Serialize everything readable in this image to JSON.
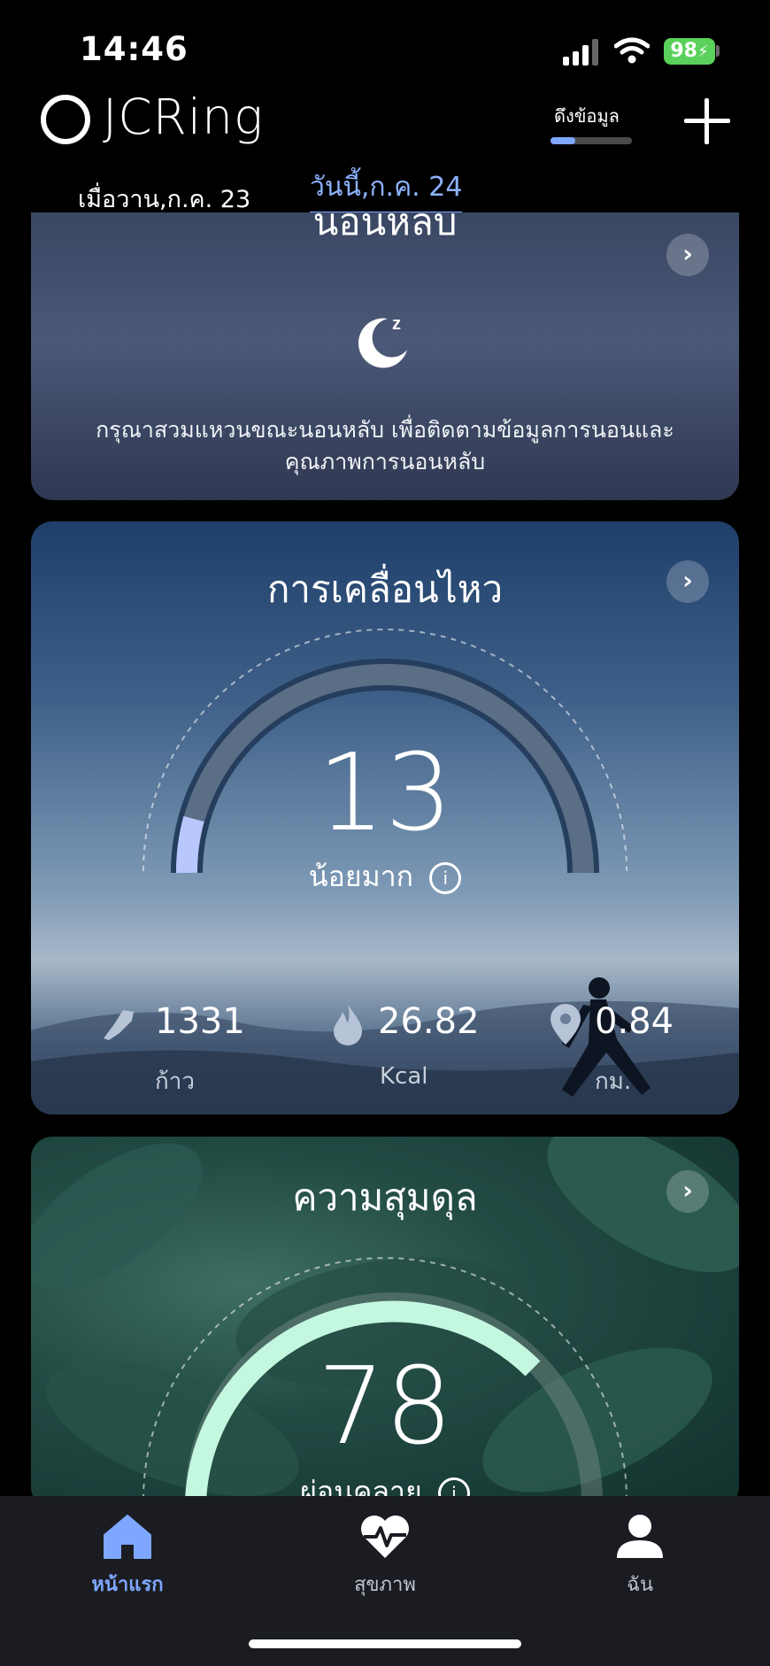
{
  "status_bar": {
    "time": "14:46",
    "battery": "98"
  },
  "header": {
    "app_title": "JCRing",
    "sync_label": "ดึงข้อมูล",
    "sync_progress": 0.3
  },
  "dates": {
    "previous": "เมื่อวาน,ก.ค. 23",
    "today": "วันนี้,ก.ค. 24"
  },
  "sleep_card": {
    "title": "นอนหลับ",
    "message_line1": "กรุณาสวมแหวนขณะนอนหลับ เพื่อติดตามข้อมูลการนอนและ",
    "message_line2": "คุณภาพการนอนหลับ"
  },
  "movement_card": {
    "title": "การเคลื่อนไหว",
    "score": "13",
    "score_label": "น้อยมาก",
    "steps": {
      "value": "1331",
      "unit": "ก้าว"
    },
    "calories": {
      "value": "26.82",
      "unit": "Kcal"
    },
    "distance": {
      "value": "0.84",
      "unit": "กม."
    }
  },
  "balance_card": {
    "title": "ความสุมดุล",
    "score": "78",
    "score_label": "ผ่อนคลาย"
  },
  "nav": {
    "home": "หน้าแรก",
    "health": "สุขภาพ",
    "me": "ฉัน"
  },
  "colors": {
    "accent": "#7ea7ff",
    "battery": "#5ad15a",
    "balance_arc": "#c4f7df"
  }
}
